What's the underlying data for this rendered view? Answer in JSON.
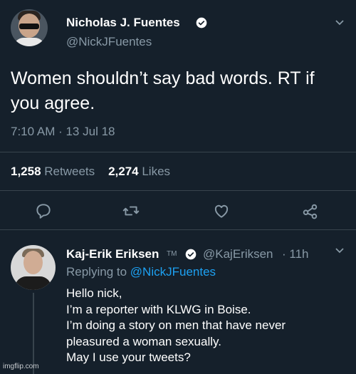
{
  "tweet": {
    "author_name": "Nicholas J. Fuentes",
    "author_handle": "@NickJFuentes",
    "text_line1": "Women shouldn’t say bad words. RT if",
    "text_line2": "you agree.",
    "timestamp": "7:10 AM · 13 Jul 18",
    "retweets_count": "1,258",
    "retweets_label": "Retweets",
    "likes_count": "2,274",
    "likes_label": "Likes"
  },
  "reply": {
    "author_name": "Kaj-Erik Eriksen",
    "author_tm": "TM",
    "author_handle": "@KajEriksen",
    "time_ago": "· 11h",
    "replying_prefix": "Replying to",
    "replying_mention": "@NickJFuentes",
    "lines": [
      "Hello nick,",
      "I’m a reporter with KLWG in Boise.",
      "I’m doing a story on men that have never",
      "pleasured a woman sexually.",
      "May I use your tweets?"
    ]
  },
  "watermark": "imgflip.com",
  "icons": {
    "verified": "verified-badge-icon",
    "menu": "chevron-down-icon",
    "reply": "reply-icon",
    "retweet": "retweet-icon",
    "like": "heart-icon",
    "share": "share-icon"
  },
  "colors": {
    "background": "#15202b",
    "secondary_text": "#8899a6",
    "link": "#1da1f2",
    "divider": "#38444d"
  }
}
